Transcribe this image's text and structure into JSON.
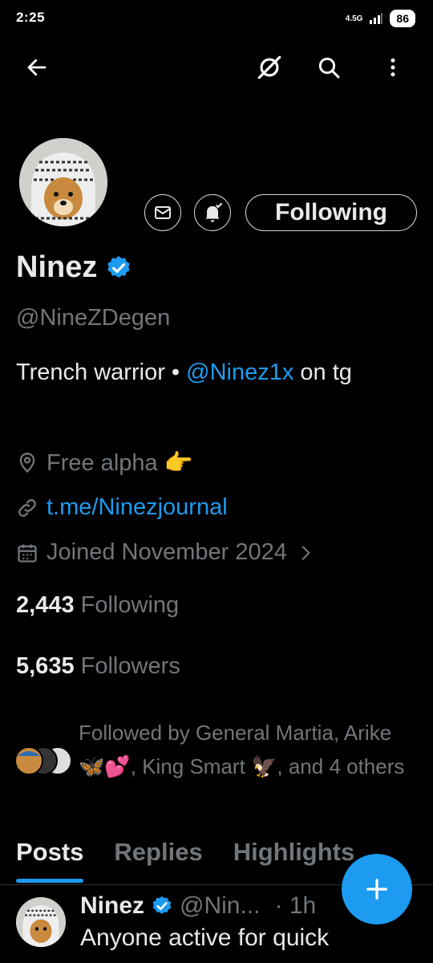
{
  "status": {
    "time": "2:25",
    "network": "4.5G",
    "battery": "86"
  },
  "profile": {
    "name": "Ninez",
    "handle": "@NineZDegen",
    "bio_text": "Trench warrior • ",
    "bio_mention": "@Ninez1x",
    "bio_suffix": " on tg",
    "location": "Free alpha 👉",
    "url": "t.me/Ninezjournal",
    "joined": "Joined November 2024",
    "following_count": "2,443",
    "following_label": "Following",
    "followers_count": "5,635",
    "followers_label": "Followers",
    "followed_by": "Followed by General Martia, Arike 🦋💕, King Smart 🦅, and 4 others"
  },
  "actions": {
    "following_button": "Following"
  },
  "tabs": [
    "Posts",
    "Replies",
    "Highlights"
  ],
  "post": {
    "name": "Ninez",
    "handle": "@Nin...",
    "time": "· 1h",
    "text": "Anyone active for quick"
  },
  "colors": {
    "accent": "#1d9bf0",
    "background": "#000000",
    "muted": "#71767b"
  }
}
